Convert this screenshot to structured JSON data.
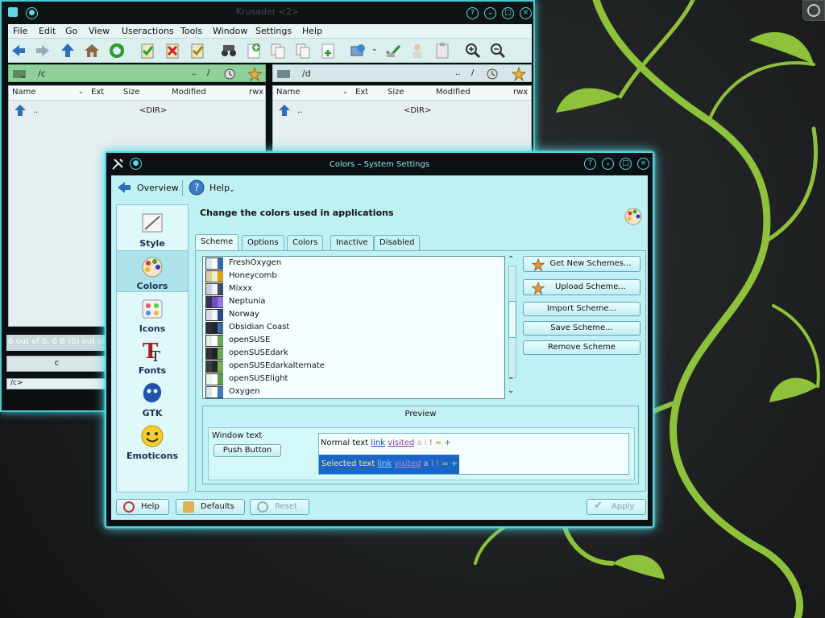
{
  "krusader": {
    "title": "Krusader <2>",
    "menu": [
      "File",
      "Edit",
      "Go",
      "View",
      "Useractions",
      "Tools",
      "Window",
      "Settings",
      "Help"
    ],
    "left_path": "/c",
    "right_path": "/d",
    "path_dots": "..",
    "path_slash": "/",
    "columns": [
      "Name",
      "Ext",
      "Size",
      "Modified",
      "rwx"
    ],
    "up_row": {
      "name": "..",
      "size": "<DIR>"
    },
    "status": "0 out of 0, 0 B (0) out of",
    "status_btn": "c",
    "cmdline": "/c>"
  },
  "settings": {
    "title": "Colors – System Settings",
    "nav": {
      "overview": "Overview",
      "help": "Help"
    },
    "categories": [
      {
        "label": "Style"
      },
      {
        "label": "Colors"
      },
      {
        "label": "Icons"
      },
      {
        "label": "Fonts"
      },
      {
        "label": "GTK"
      },
      {
        "label": "Emoticons"
      }
    ],
    "heading": "Change the colors used in applications",
    "tabs": [
      "Scheme",
      "Options",
      "Colors",
      "Inactive",
      "Disabled"
    ],
    "schemes": [
      {
        "name": "FreshOxygen",
        "colors": [
          "#dce8f2",
          "#ffffff",
          "#2a6ab7"
        ]
      },
      {
        "name": "Honeycomb",
        "colors": [
          "#d8cfa6",
          "#f4ecd1",
          "#e39c1c"
        ]
      },
      {
        "name": "Mixxx",
        "colors": [
          "#c9d3df",
          "#eef1f4",
          "#3a4e6c"
        ]
      },
      {
        "name": "Neptunia",
        "colors": [
          "#3b2c6a",
          "#6f4fb6",
          "#9277e8"
        ]
      },
      {
        "name": "Norway",
        "colors": [
          "#d8dde8",
          "#f6f7fa",
          "#2a4a8c"
        ]
      },
      {
        "name": "Obsidian Coast",
        "colors": [
          "#2b2f33",
          "#20252a",
          "#3b6aa3"
        ]
      },
      {
        "name": "openSUSE",
        "colors": [
          "#e4ece6",
          "#ffffff",
          "#6aa84f"
        ]
      },
      {
        "name": "openSUSEdark",
        "colors": [
          "#2f3532",
          "#1e2422",
          "#6aa84f"
        ]
      },
      {
        "name": "openSUSEdarkalternate",
        "colors": [
          "#3a403c",
          "#242a27",
          "#73b057"
        ]
      },
      {
        "name": "openSUSElight",
        "colors": [
          "#eef3ef",
          "#ffffff",
          "#5c9e43"
        ]
      },
      {
        "name": "Oxygen",
        "colors": [
          "#dfe4ea",
          "#ffffff",
          "#3d7bc4"
        ]
      }
    ],
    "actions": [
      "Get New Schemes...",
      "Upload Scheme...",
      "Import Scheme...",
      "Save Scheme...",
      "Remove Scheme"
    ],
    "preview": {
      "title": "Preview",
      "window_text": "Window text",
      "push_button": "Push Button",
      "normal_text": "Normal text",
      "selected_text": "Selected text",
      "link": "link",
      "visited": "visited",
      "a": "a",
      "i": "i",
      "bang": "!",
      "eq": "=",
      "plus": "+"
    },
    "footer": {
      "help": "Help",
      "defaults": "Defaults",
      "reset": "Reset",
      "apply": "Apply"
    }
  }
}
